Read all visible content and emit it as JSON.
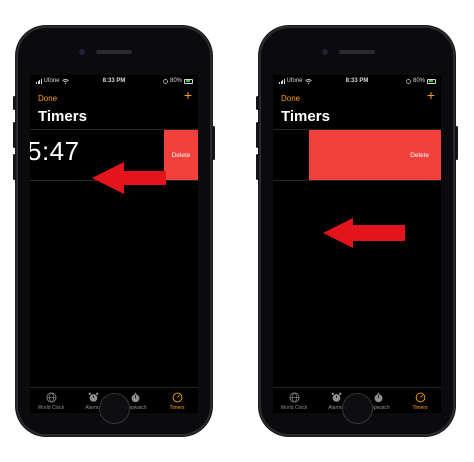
{
  "colors": {
    "accent": "#ff9f0a",
    "delete": "#f2403b",
    "arrow": "#e3141c"
  },
  "left": {
    "status": {
      "carrier": "Ufone",
      "time": "8:33 PM",
      "battery": "80%"
    },
    "nav": {
      "done": "Done",
      "add": "+"
    },
    "title": "Timers",
    "timer_value": "5:47",
    "delete_label": "Delete",
    "tabs": [
      {
        "label": "World Clock",
        "icon": "globe-icon"
      },
      {
        "label": "Alarms",
        "icon": "alarm-clock-icon"
      },
      {
        "label": "Stopwatch",
        "icon": "stopwatch-icon"
      },
      {
        "label": "Timers",
        "icon": "timer-icon"
      }
    ]
  },
  "right": {
    "status": {
      "carrier": "Ufone",
      "time": "8:33 PM",
      "battery": "80%"
    },
    "nav": {
      "done": "Done",
      "add": "+"
    },
    "title": "Timers",
    "delete_label": "Delete",
    "tabs": [
      {
        "label": "World Clock",
        "icon": "globe-icon"
      },
      {
        "label": "Alarms",
        "icon": "alarm-clock-icon"
      },
      {
        "label": "Stopwatch",
        "icon": "stopwatch-icon"
      },
      {
        "label": "Timers",
        "icon": "timer-icon"
      }
    ]
  }
}
